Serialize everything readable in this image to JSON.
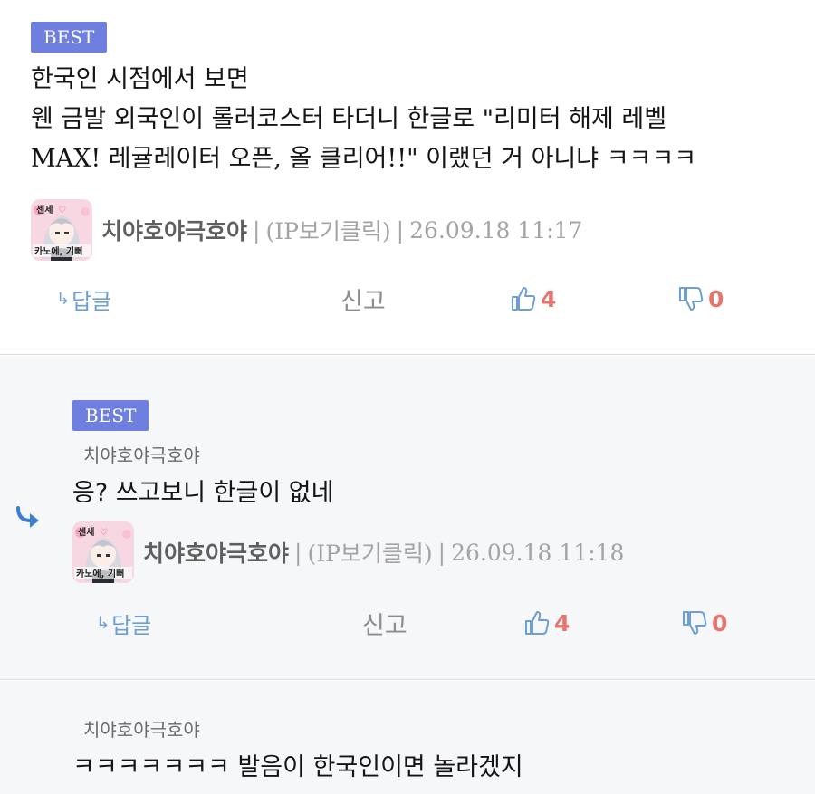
{
  "comments": [
    {
      "badge": "BEST",
      "lines": [
        "한국인 시점에서 보면",
        "웬 금발 외국인이 롤러코스터 타더니 한글로 \"리미터 해제 레벨",
        "MAX! 레귤레이터 오픈, 올 클리어!!\" 이랬던 거 아니냐 ㅋㅋㅋㅋ"
      ],
      "author": "치야호야극호야",
      "avatar_caption": "센세♡ / 카노에, 기뻐",
      "ip": "(IP보기클릭)",
      "timestamp": "26.09.18 11:17",
      "reply_label": "답글",
      "report_label": "신고",
      "likes": "4",
      "dislikes": "0"
    },
    {
      "badge": "BEST",
      "parent_nick": "치야호야극호야",
      "lines": [
        "응? 쓰고보니 한글이 없네"
      ],
      "author": "치야호야극호야",
      "ip": "(IP보기클릭)",
      "timestamp": "26.09.18 11:18",
      "reply_label": "답글",
      "report_label": "신고",
      "likes": "4",
      "dislikes": "0"
    },
    {
      "parent_nick": "치야호야극호야",
      "lines": [
        "ㅋㅋㅋㅋㅋㅋㅋ 발음이 한국인이면 놀라겠지"
      ]
    }
  ],
  "meta_separator": "|",
  "icons": {
    "reply": "reply-arrow-icon",
    "like": "thumbs-up-icon",
    "dislike": "thumbs-down-icon",
    "reply_marker": "reply-indent-arrow-icon"
  },
  "colors": {
    "best_badge": "#6f7fe0",
    "reply_blue": "#6e9fd4",
    "count_red": "#e6756d",
    "reply_marker": "#3c7fd0"
  }
}
